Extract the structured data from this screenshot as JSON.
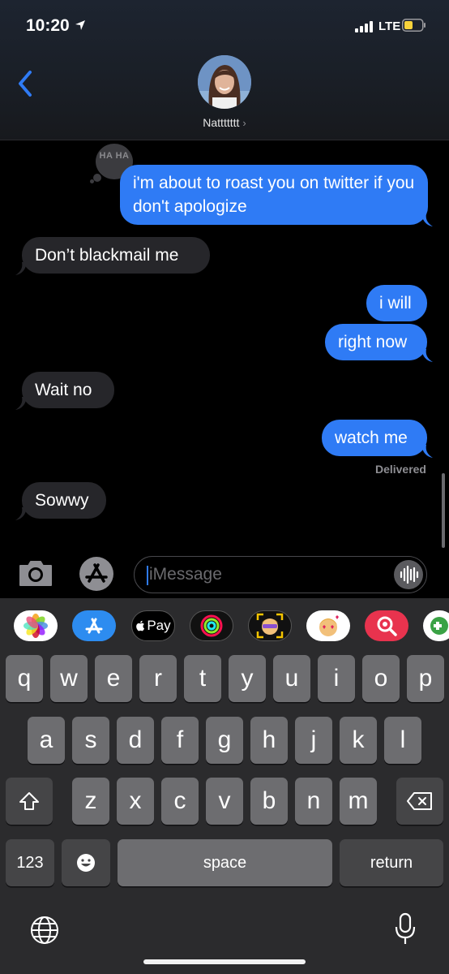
{
  "status_bar": {
    "time": "10:20",
    "network": "LTE"
  },
  "header": {
    "contact_name": "Nattttttt",
    "chevron": "›"
  },
  "messages": [
    {
      "side": "sent",
      "text": "i'm about to roast you on twitter if you don't apologize",
      "tapback": "HA HA"
    },
    {
      "side": "received",
      "text": "Don’t blackmail me"
    },
    {
      "side": "sent",
      "text": "i will"
    },
    {
      "side": "sent",
      "text": "right now"
    },
    {
      "side": "received",
      "text": "Wait no"
    },
    {
      "side": "sent",
      "text": "watch me"
    },
    {
      "side": "received",
      "text": "Sowwy"
    }
  ],
  "delivered_label": "Delivered",
  "input": {
    "placeholder": "iMessage"
  },
  "app_strip": [
    "photos-icon",
    "app-store-icon",
    "apple-pay-icon",
    "activity-icon",
    "memoji-icon",
    "memoji-stickers-icon",
    "images-search-icon",
    "game-icon"
  ],
  "app_strip_labels": {
    "pay": "Pay"
  },
  "keyboard": {
    "row1": [
      "q",
      "w",
      "e",
      "r",
      "t",
      "y",
      "u",
      "i",
      "o",
      "p"
    ],
    "row2": [
      "a",
      "s",
      "d",
      "f",
      "g",
      "h",
      "j",
      "k",
      "l"
    ],
    "row3": [
      "z",
      "x",
      "c",
      "v",
      "b",
      "n",
      "m"
    ],
    "numbers": "123",
    "space": "space",
    "return": "return"
  },
  "colors": {
    "sent_bubble": "#2f7bf5",
    "received_bubble": "#26262a",
    "accent": "#2f7bf5"
  }
}
